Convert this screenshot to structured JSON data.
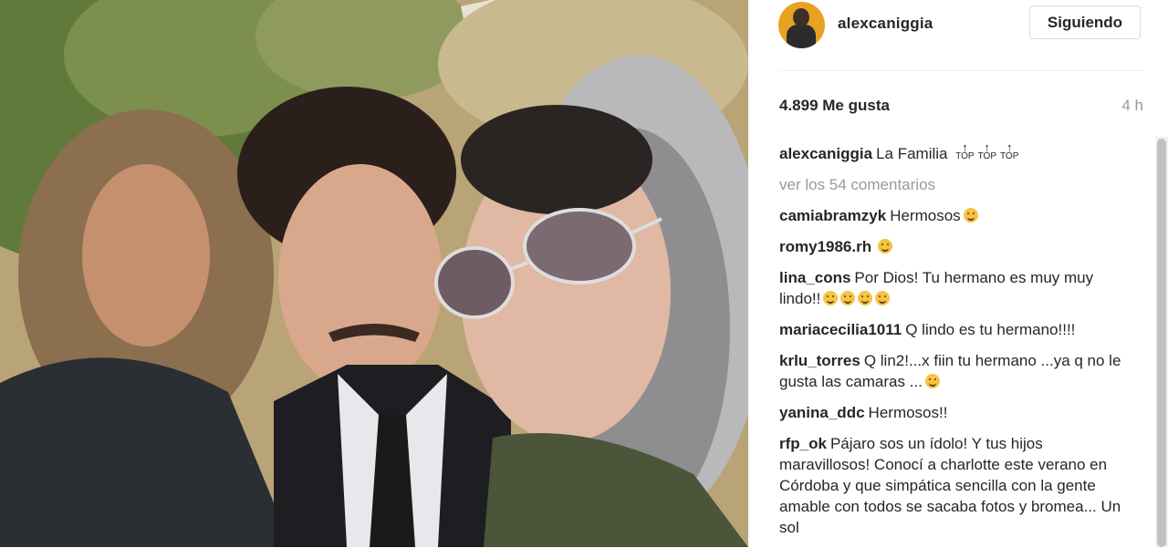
{
  "post": {
    "author": "alexcaniggia",
    "follow_label": "Siguiendo",
    "likes": "4.899 Me gusta",
    "time": "4 h",
    "caption_user": "alexcaniggia",
    "caption_text": "La Familia",
    "caption_icons": [
      "top-icon",
      "top-icon",
      "top-icon"
    ],
    "view_comments": "ver los 54 comentarios"
  },
  "comments": [
    {
      "user": "camiabramzyk",
      "text": "Hermosos",
      "emoji_count": 1
    },
    {
      "user": "romy1986.rh",
      "text": "",
      "emoji_count": 1
    },
    {
      "user": "lina_cons",
      "text": "Por Dios! Tu hermano es muy muy lindo!!",
      "emoji_count": 4
    },
    {
      "user": "mariacecilia1011",
      "text": "Q lindo es tu hermano!!!!",
      "emoji_count": 0
    },
    {
      "user": "krlu_torres",
      "text": "Q lin2!...x fiin tu hermano ...ya q no le gusta las camaras ...",
      "emoji_count": 1
    },
    {
      "user": "yanina_ddc",
      "text": "Hermosos!!",
      "emoji_count": 0
    },
    {
      "user": "rfp_ok",
      "text": "Pájaro sos un ídolo! Y tus hijos maravillosos! Conocí a charlotte este verano en Córdoba y que simpática sencilla con la gente amable con todos se sacaba fotos y bromea... Un sol",
      "emoji_count": 0
    }
  ],
  "colors": {
    "accent_avatar": "#e8a21f",
    "emoji": "#f6c343",
    "muted": "#999999"
  }
}
